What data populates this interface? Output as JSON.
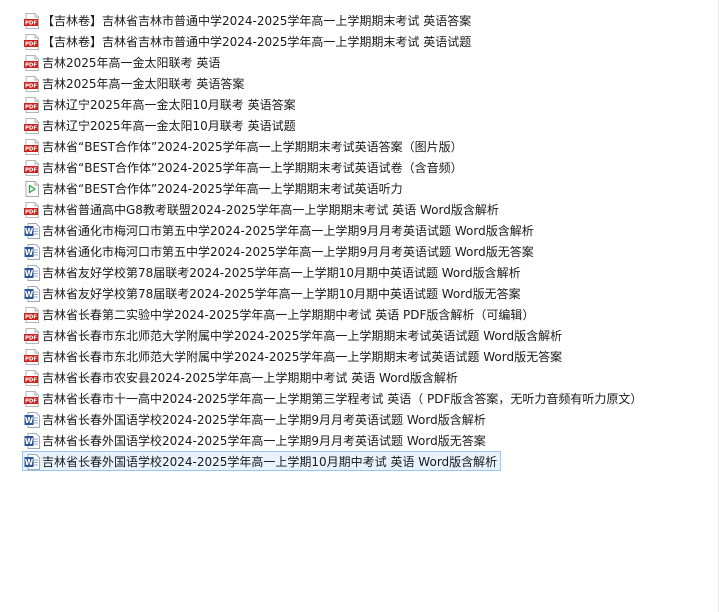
{
  "files": [
    {
      "icon": "pdf-icon",
      "name": "【吉林卷】吉林省吉林市普通中学2024-2025学年高一上学期期末考试 英语答案"
    },
    {
      "icon": "pdf-icon",
      "name": "【吉林卷】吉林省吉林市普通中学2024-2025学年高一上学期期末考试 英语试题"
    },
    {
      "icon": "pdf-icon",
      "name": "吉林2025年高一金太阳联考 英语"
    },
    {
      "icon": "pdf-icon",
      "name": "吉林2025年高一金太阳联考 英语答案"
    },
    {
      "icon": "pdf-icon",
      "name": "吉林辽宁2025年高一金太阳10月联考 英语答案"
    },
    {
      "icon": "pdf-icon",
      "name": "吉林辽宁2025年高一金太阳10月联考 英语试题"
    },
    {
      "icon": "pdf-icon",
      "name": "吉林省“BEST合作体”2024-2025学年高一上学期期末考试英语答案（图片版）"
    },
    {
      "icon": "pdf-icon",
      "name": "吉林省“BEST合作体”2024-2025学年高一上学期期末考试英语试卷（含音频）"
    },
    {
      "icon": "audio-icon",
      "name": "吉林省“BEST合作体”2024-2025学年高一上学期期末考试英语听力"
    },
    {
      "icon": "pdf-icon",
      "name": "吉林省普通高中G8教考联盟2024-2025学年高一上学期期末考试 英语 Word版含解析"
    },
    {
      "icon": "word-icon",
      "name": "吉林省通化市梅河口市第五中学2024-2025学年高一上学期9月月考英语试题  Word版含解析"
    },
    {
      "icon": "word-icon",
      "name": "吉林省通化市梅河口市第五中学2024-2025学年高一上学期9月月考英语试题  Word版无答案"
    },
    {
      "icon": "word-icon",
      "name": "吉林省友好学校第78届联考2024-2025学年高一上学期10月期中英语试题  Word版含解析"
    },
    {
      "icon": "word-icon",
      "name": "吉林省友好学校第78届联考2024-2025学年高一上学期10月期中英语试题  Word版无答案"
    },
    {
      "icon": "pdf-icon",
      "name": "吉林省长春第二实验中学2024-2025学年高一上学期期中考试 英语 PDF版含解析（可编辑）"
    },
    {
      "icon": "pdf-icon",
      "name": "吉林省长春市东北师范大学附属中学2024-2025学年高一上学期期末考试英语试题  Word版含解析"
    },
    {
      "icon": "pdf-icon",
      "name": "吉林省长春市东北师范大学附属中学2024-2025学年高一上学期期末考试英语试题  Word版无答案"
    },
    {
      "icon": "pdf-icon",
      "name": "吉林省长春市农安县2024-2025学年高一上学期期中考试 英语 Word版含解析"
    },
    {
      "icon": "pdf-icon",
      "name": "吉林省长春市十一高中2024-2025学年高一上学期第三学程考试 英语（ PDF版含答案，无听力音频有听力原文）"
    },
    {
      "icon": "word-icon",
      "name": "吉林省长春外国语学校2024-2025学年高一上学期9月月考英语试题  Word版含解析"
    },
    {
      "icon": "word-icon",
      "name": "吉林省长春外国语学校2024-2025学年高一上学期9月月考英语试题  Word版无答案"
    },
    {
      "icon": "word-icon",
      "name": "吉林省长春外国语学校2024-2025学年高一上学期10月期中考试 英语 Word版含解析"
    }
  ],
  "selected_index": 21,
  "colors": {
    "pdf_red": "#c9211e",
    "word_blue": "#2b5797",
    "audio_green": "#2e9e44",
    "selection_border": "#99c6f0",
    "selection_fill": "#e8f3fd"
  }
}
